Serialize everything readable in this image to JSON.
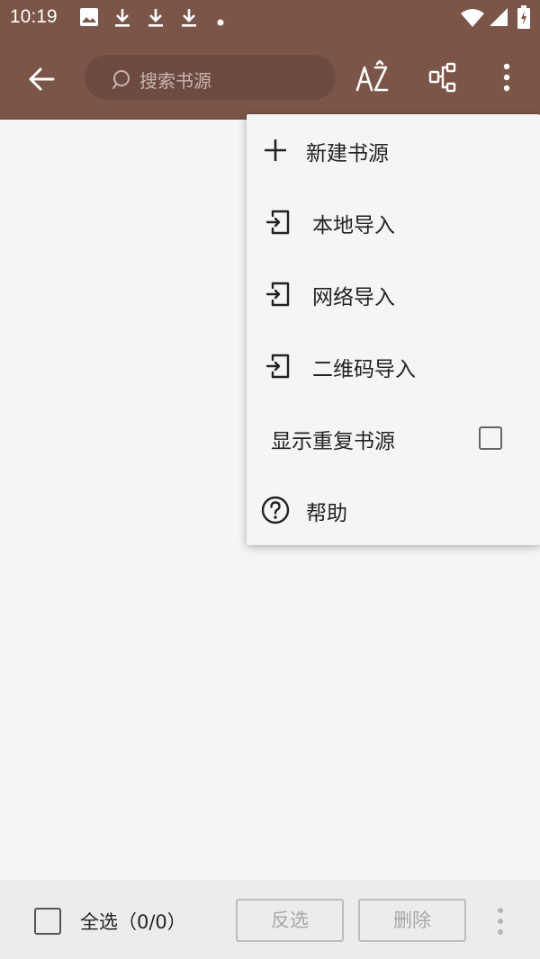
{
  "status_bar": {
    "time": "10:19",
    "icons": [
      "image-icon",
      "download-icon",
      "download-icon",
      "download-icon",
      "dot-icon",
      "wifi-icon",
      "signal-icon",
      "battery-icon"
    ]
  },
  "toolbar": {
    "back_icon": "arrow-left-icon",
    "search": {
      "placeholder": "搜索书源",
      "value": ""
    },
    "actions": [
      "sort-az-icon",
      "group-icon",
      "more-vert-icon"
    ]
  },
  "menu": {
    "items": [
      {
        "label": "新建书源",
        "icon": "plus-icon"
      },
      {
        "label": "本地导入",
        "icon": "import-icon"
      },
      {
        "label": "网络导入",
        "icon": "import-icon"
      },
      {
        "label": "二维码导入",
        "icon": "import-icon"
      },
      {
        "label": "显示重复书源",
        "checked": false
      },
      {
        "label": "帮助",
        "icon": "help-icon"
      }
    ]
  },
  "bottom_bar": {
    "select_all_label": "全选（0/0）",
    "select_all_checked": false,
    "invert_label": "反选",
    "delete_label": "删除",
    "more_icon": "more-vert-icon"
  },
  "colors": {
    "primary": "#7b5548",
    "search_bg": "#6d4b40",
    "background": "#f5f5f5",
    "bottom_bar": "#ececec",
    "disabled_text": "#a8a8a8"
  }
}
